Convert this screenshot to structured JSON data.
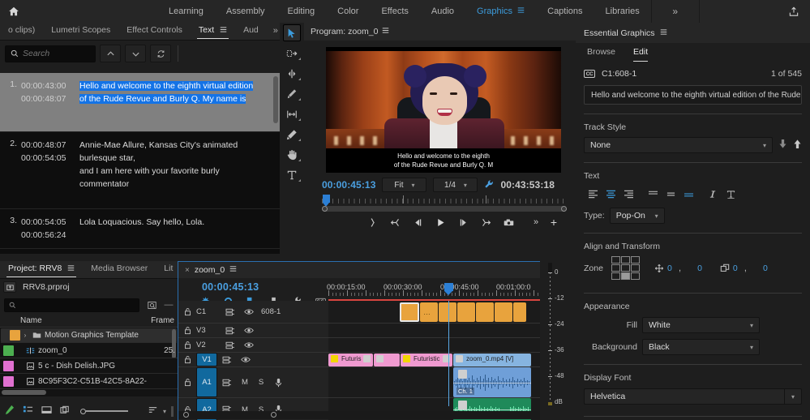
{
  "app": {
    "workspace_tabs": [
      {
        "label": "Learning",
        "active": false
      },
      {
        "label": "Assembly",
        "active": false
      },
      {
        "label": "Editing",
        "active": false
      },
      {
        "label": "Color",
        "active": false
      },
      {
        "label": "Effects",
        "active": false
      },
      {
        "label": "Audio",
        "active": false
      },
      {
        "label": "Graphics",
        "active": true
      },
      {
        "label": "Captions",
        "active": false
      },
      {
        "label": "Libraries",
        "active": false
      }
    ],
    "more_label": "»",
    "home_icon": "home-icon",
    "share_icon": "share-export-icon"
  },
  "text_panel": {
    "tabs": [
      {
        "label": "o clips)",
        "active": false
      },
      {
        "label": "Lumetri Scopes",
        "active": false
      },
      {
        "label": "Effect Controls",
        "active": false
      },
      {
        "label": "Text",
        "active": true
      },
      {
        "label": "Aud",
        "active": false
      }
    ],
    "more_label": "»",
    "search_placeholder": "Search",
    "search_value": "",
    "prev_label": "⌃",
    "next_label": "⌄",
    "captions": [
      {
        "num": "1.",
        "start": "00:00:43:00",
        "end": "00:00:48:07",
        "lines": [
          "Hello and welcome to the eighth virtual edition",
          "of the Rude Revue and Burly Q. My name is"
        ],
        "selected": true
      },
      {
        "num": "2.",
        "start": "00:00:48:07",
        "end": "00:00:54:05",
        "lines": [
          "Annie-Mae Allure, Kansas City's animated",
          "burlesque star,",
          "and I am here with your favorite burly",
          "commentator"
        ],
        "selected": false
      },
      {
        "num": "3.",
        "start": "00:00:54:05",
        "end": "00:00:56:24",
        "lines": [
          "Lola Loquacious. Say hello, Lola."
        ],
        "selected": false
      }
    ]
  },
  "tools": [
    {
      "name": "selection-tool",
      "active": true
    },
    {
      "name": "track-select-forward-tool",
      "active": false
    },
    {
      "name": "ripple-edit-tool",
      "active": false
    },
    {
      "name": "razor-tool",
      "active": false
    },
    {
      "name": "slip-tool",
      "active": false
    },
    {
      "name": "pen-tool",
      "active": false
    },
    {
      "name": "hand-tool",
      "active": false
    },
    {
      "name": "type-tool",
      "active": false
    }
  ],
  "program": {
    "title": "Program: zoom_0",
    "playhead_timecode": "00:00:45:13",
    "fit_value": "Fit",
    "resolution_value": "1/4",
    "duration_timecode": "00:43:53:18",
    "caption_overlay": [
      "Hello and welcome to the eighth",
      "of the Rude Revue and Burly Q. M"
    ],
    "buttons": [
      {
        "name": "mark-in-out-button",
        "glyph": "}"
      },
      {
        "name": "go-to-in-button",
        "glyph": "{←"
      },
      {
        "name": "step-back-button",
        "glyph": "◀|"
      },
      {
        "name": "play-stop-button",
        "glyph": "▶"
      },
      {
        "name": "step-forward-button",
        "glyph": "|▶"
      },
      {
        "name": "go-to-out-button",
        "glyph": "→}"
      },
      {
        "name": "export-frame-button",
        "glyph": "📷"
      },
      {
        "name": "more-button",
        "glyph": "»"
      },
      {
        "name": "button-editor-button",
        "glyph": "+"
      }
    ]
  },
  "essential_graphics": {
    "title": "Essential Graphics",
    "tabs": [
      {
        "label": "Browse",
        "active": false
      },
      {
        "label": "Edit",
        "active": true
      }
    ],
    "caption_badge": "CC",
    "caption_id": "C1:608-1",
    "caption_count": "1 of 545",
    "caption_text": "Hello and welcome to the eighth virtual edition of the Rude Revue…",
    "track_style_label": "Track Style",
    "track_style_value": "None",
    "text_label": "Text",
    "type_label": "Type:",
    "type_value": "Pop-On",
    "align_transform_label": "Align and Transform",
    "zone_label": "Zone",
    "zone_selected_index": 7,
    "position_x": "0",
    "position_y": "0",
    "scale_x": "0",
    "scale_y": "0",
    "appearance_label": "Appearance",
    "fill_label": "Fill",
    "fill_value": "White",
    "background_label": "Background",
    "background_value": "Black",
    "display_font_label": "Display Font",
    "display_font_value": "Helvetica",
    "accent_color": "#4a9fe0"
  },
  "project": {
    "tabs": [
      {
        "label": "Project: RRV8",
        "active": true
      },
      {
        "label": "Media Browser",
        "active": false
      },
      {
        "label": "Lit",
        "active": false
      }
    ],
    "more_label": "»",
    "project_file": "RRV8.prproj",
    "search_value": "",
    "columns": [
      "Name",
      "Frame"
    ],
    "items": [
      {
        "chip": "#e8a33d",
        "twirl": "›",
        "icon": "folder-icon",
        "label": "Motion Graphics Template",
        "frame": "",
        "selected": true
      },
      {
        "chip": "#4caf50",
        "twirl": "",
        "icon": "sequence-icon",
        "label": "zoom_0",
        "frame": "25.",
        "selected": false
      },
      {
        "chip": "#e070d0",
        "twirl": "",
        "icon": "image-icon",
        "label": "5 c - Dish Delish.JPG",
        "frame": "",
        "selected": false
      },
      {
        "chip": "#e070d0",
        "twirl": "",
        "icon": "image-icon",
        "label": "8C95F3C2-C51B-42C5-8A22-",
        "frame": "",
        "selected": false
      }
    ],
    "footer_icons": [
      "new-item-pen-icon",
      "list-view-icon",
      "icon-view-icon",
      "freeform-view-icon",
      "zoom-slider",
      "sort-icon",
      "chevron-down-icon",
      "gripper-icon"
    ]
  },
  "timeline": {
    "sequence_name": "zoom_0",
    "close_label": "×",
    "playhead_timecode": "00:00:45:13",
    "tools": [
      "nest-icon",
      "snap-magnet-icon",
      "linked-selection-icon",
      "marker-icon",
      "wrench-icon",
      "cc-icon"
    ],
    "ruler_labels": [
      "00:00:15:00",
      "00:00:30:00",
      "00:00:45:00",
      "00:01:00:0"
    ],
    "tracks": [
      {
        "name": "C1",
        "kind": "caption",
        "label": "608-1",
        "locked": false,
        "selected": false
      },
      {
        "name": "V3",
        "kind": "video",
        "label": "",
        "locked": false,
        "selected": false
      },
      {
        "name": "V2",
        "kind": "video",
        "label": "",
        "locked": false,
        "selected": false
      },
      {
        "name": "V1",
        "kind": "video",
        "label": "",
        "locked": false,
        "selected": true
      },
      {
        "name": "A1",
        "kind": "audio",
        "label": "",
        "locked": false,
        "selected": true,
        "mute": "M",
        "solo": "S"
      },
      {
        "name": "A2",
        "kind": "audio",
        "label": "",
        "locked": false,
        "selected": true,
        "mute": "M",
        "solo": "S"
      }
    ],
    "clips": {
      "v1_labels": [
        "Futuris",
        "Futuristic",
        "zoom_0.mp4 [V]"
      ],
      "a1_label": "Ch. 1"
    }
  },
  "audio_meter": {
    "labels": [
      "0",
      "-12",
      "-24",
      "-36",
      "-48",
      "dB"
    ]
  }
}
